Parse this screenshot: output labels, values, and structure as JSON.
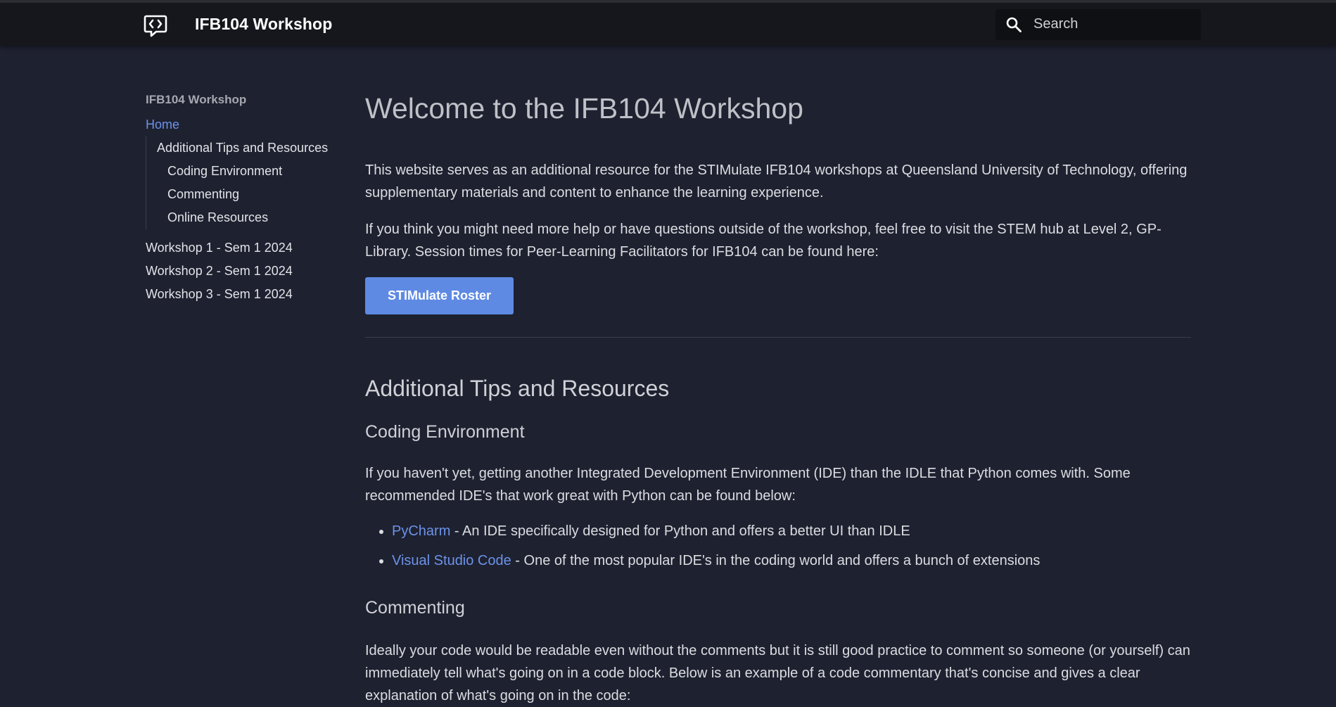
{
  "header": {
    "site_title": "IFB104 Workshop",
    "logo_icon": "code-comment-icon",
    "search_placeholder": "Search"
  },
  "sidebar": {
    "title": "IFB104 Workshop",
    "home": "Home",
    "section": "Additional Tips and Resources",
    "subsections": [
      "Coding Environment",
      "Commenting",
      "Online Resources"
    ],
    "workshops": [
      "Workshop 1 - Sem 1 2024",
      "Workshop 2 - Sem 1 2024",
      "Workshop 3 - Sem 1 2024"
    ]
  },
  "main": {
    "title": "Welcome to the IFB104 Workshop",
    "intro": "This website serves as an additional resource for the STIMulate IFB104 workshops at Queensland University of Technology, offering supplementary materials and content to enhance the learning experience.",
    "help": "If you think you might need more help or have questions outside of the workshop, feel free to visit the STEM hub at Level 2, GP-Library. Session times for Peer-Learning Facilitators for IFB104 can be found here:",
    "roster_button": "STIMulate Roster",
    "tips_heading": "Additional Tips and Resources",
    "coding_env_heading": "Coding Environment",
    "coding_env_text": "If you haven't yet, getting another Integrated Development Environment (IDE) than the IDLE that Python comes with. Some recommended IDE's that work great with Python can be found below:",
    "ide_links": [
      {
        "name": "PyCharm",
        "desc": " - An IDE specifically designed for Python and offers a better UI than IDLE"
      },
      {
        "name": "Visual Studio Code",
        "desc": " - One of the most popular IDE's in the coding world and offers a bunch of extensions"
      }
    ],
    "commenting_heading": "Commenting",
    "commenting_text": "Ideally your code would be readable even without the comments but it is still good practice to comment so someone (or yourself) can immediately tell what's going on in a code block. Below is an example of a code commentary that's concise and gives a clear explanation of what's going on in the code:"
  },
  "colors": {
    "background": "#1e2130",
    "header": "#16171d",
    "accent": "#6c93e9",
    "button": "#5e8ae3"
  }
}
